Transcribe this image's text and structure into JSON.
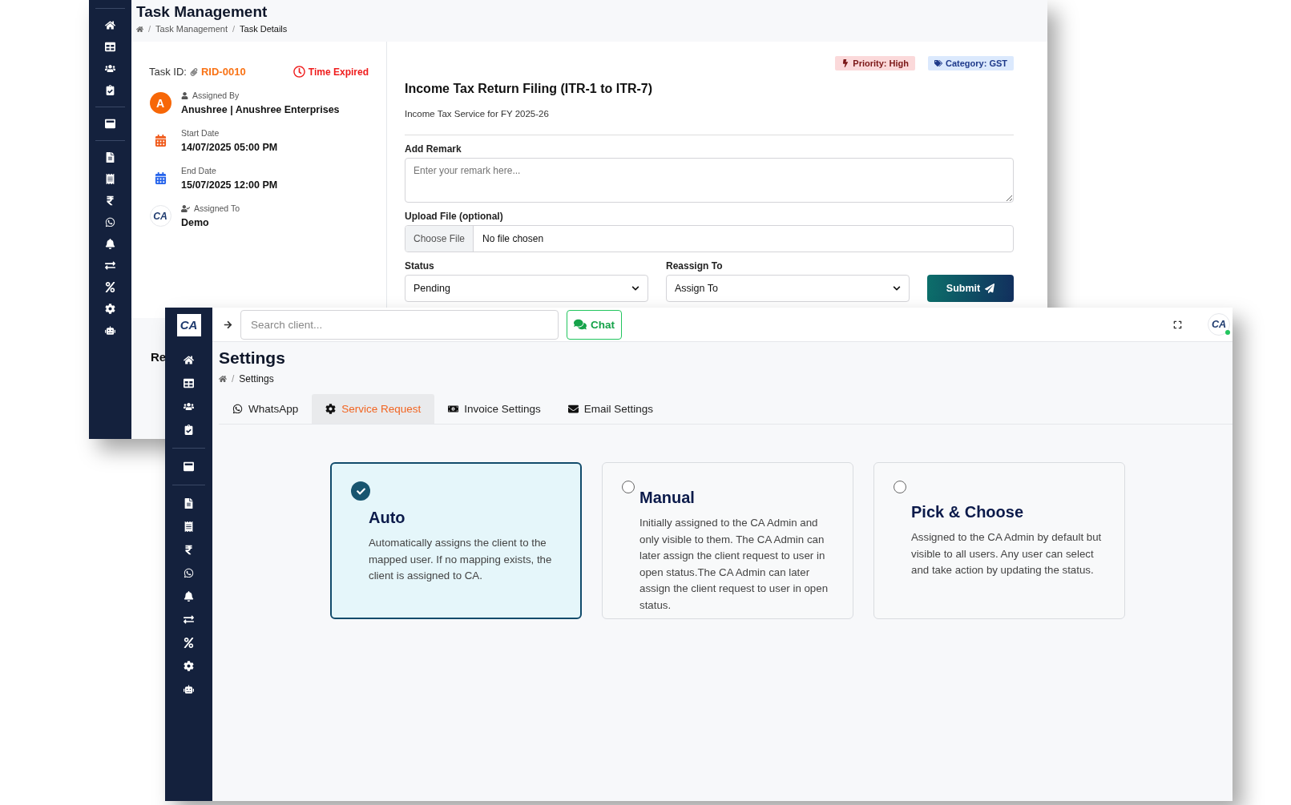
{
  "back_window": {
    "title": "Task Management",
    "breadcrumb": [
      "Task Management",
      "Task Details"
    ],
    "breadcrumb_separator": "/",
    "task": {
      "id_label": "Task ID:",
      "id": "RID-0010",
      "status": "Time Expired",
      "details": [
        {
          "kind": "avatar",
          "avatar_letter": "A",
          "label": "Assigned By",
          "value": "Anushree | Anushree Enterprises"
        },
        {
          "kind": "start",
          "label": "Start Date",
          "value": "14/07/2025 05:00 PM"
        },
        {
          "kind": "end",
          "label": "End Date",
          "value": "15/07/2025 12:00 PM"
        },
        {
          "kind": "logo",
          "logo_text": "CA",
          "label": "Assigned To",
          "value": "Demo"
        }
      ]
    },
    "badges": [
      {
        "kind": "priority",
        "text": "Priority: High"
      },
      {
        "kind": "category",
        "text": "Category: GST"
      }
    ],
    "service_title": "Income Tax Return Filing (ITR-1 to ITR-7)",
    "service_subtitle": "Income Tax Service for FY 2025-26",
    "remark": {
      "label": "Add Remark",
      "placeholder": "Enter your remark here..."
    },
    "upload": {
      "label": "Upload File (optional)",
      "button": "Choose File",
      "value": "No file chosen"
    },
    "status": {
      "label": "Status",
      "value": "Pending"
    },
    "reassign": {
      "label": "Reassign To",
      "value": "Assign To"
    },
    "submit": "Submit",
    "lower_heading": "Re"
  },
  "front_window": {
    "logo_text": "CA",
    "search": {
      "placeholder": "Search client..."
    },
    "chat_button": "Chat",
    "avatar": {
      "logo_text": "CA",
      "online": true
    },
    "title": "Settings",
    "breadcrumb": [
      "Settings"
    ],
    "breadcrumb_separator": "/",
    "tabs": [
      {
        "kind": "whatsapp",
        "label": "WhatsApp",
        "selected": false
      },
      {
        "kind": "gear",
        "label": "Service Request",
        "selected": true
      },
      {
        "kind": "money",
        "label": "Invoice Settings",
        "selected": false
      },
      {
        "kind": "mail",
        "label": "Email Settings",
        "selected": false
      }
    ],
    "options": [
      {
        "title": "Auto",
        "description": "Automatically assigns the client to the mapped user. If no mapping exists, the client is assigned to CA.",
        "selected": true
      },
      {
        "title": "Manual",
        "description": "Initially assigned to the CA Admin and only visible to them. The CA Admin can later assign the client request to user in open status.The CA Admin can later assign the client request to user in open status.",
        "selected": false
      },
      {
        "title": "Pick & Choose",
        "description": "Assigned to the CA Admin by default but visible to all users. Any user can select and take action by updating the status.",
        "selected": false
      }
    ]
  }
}
